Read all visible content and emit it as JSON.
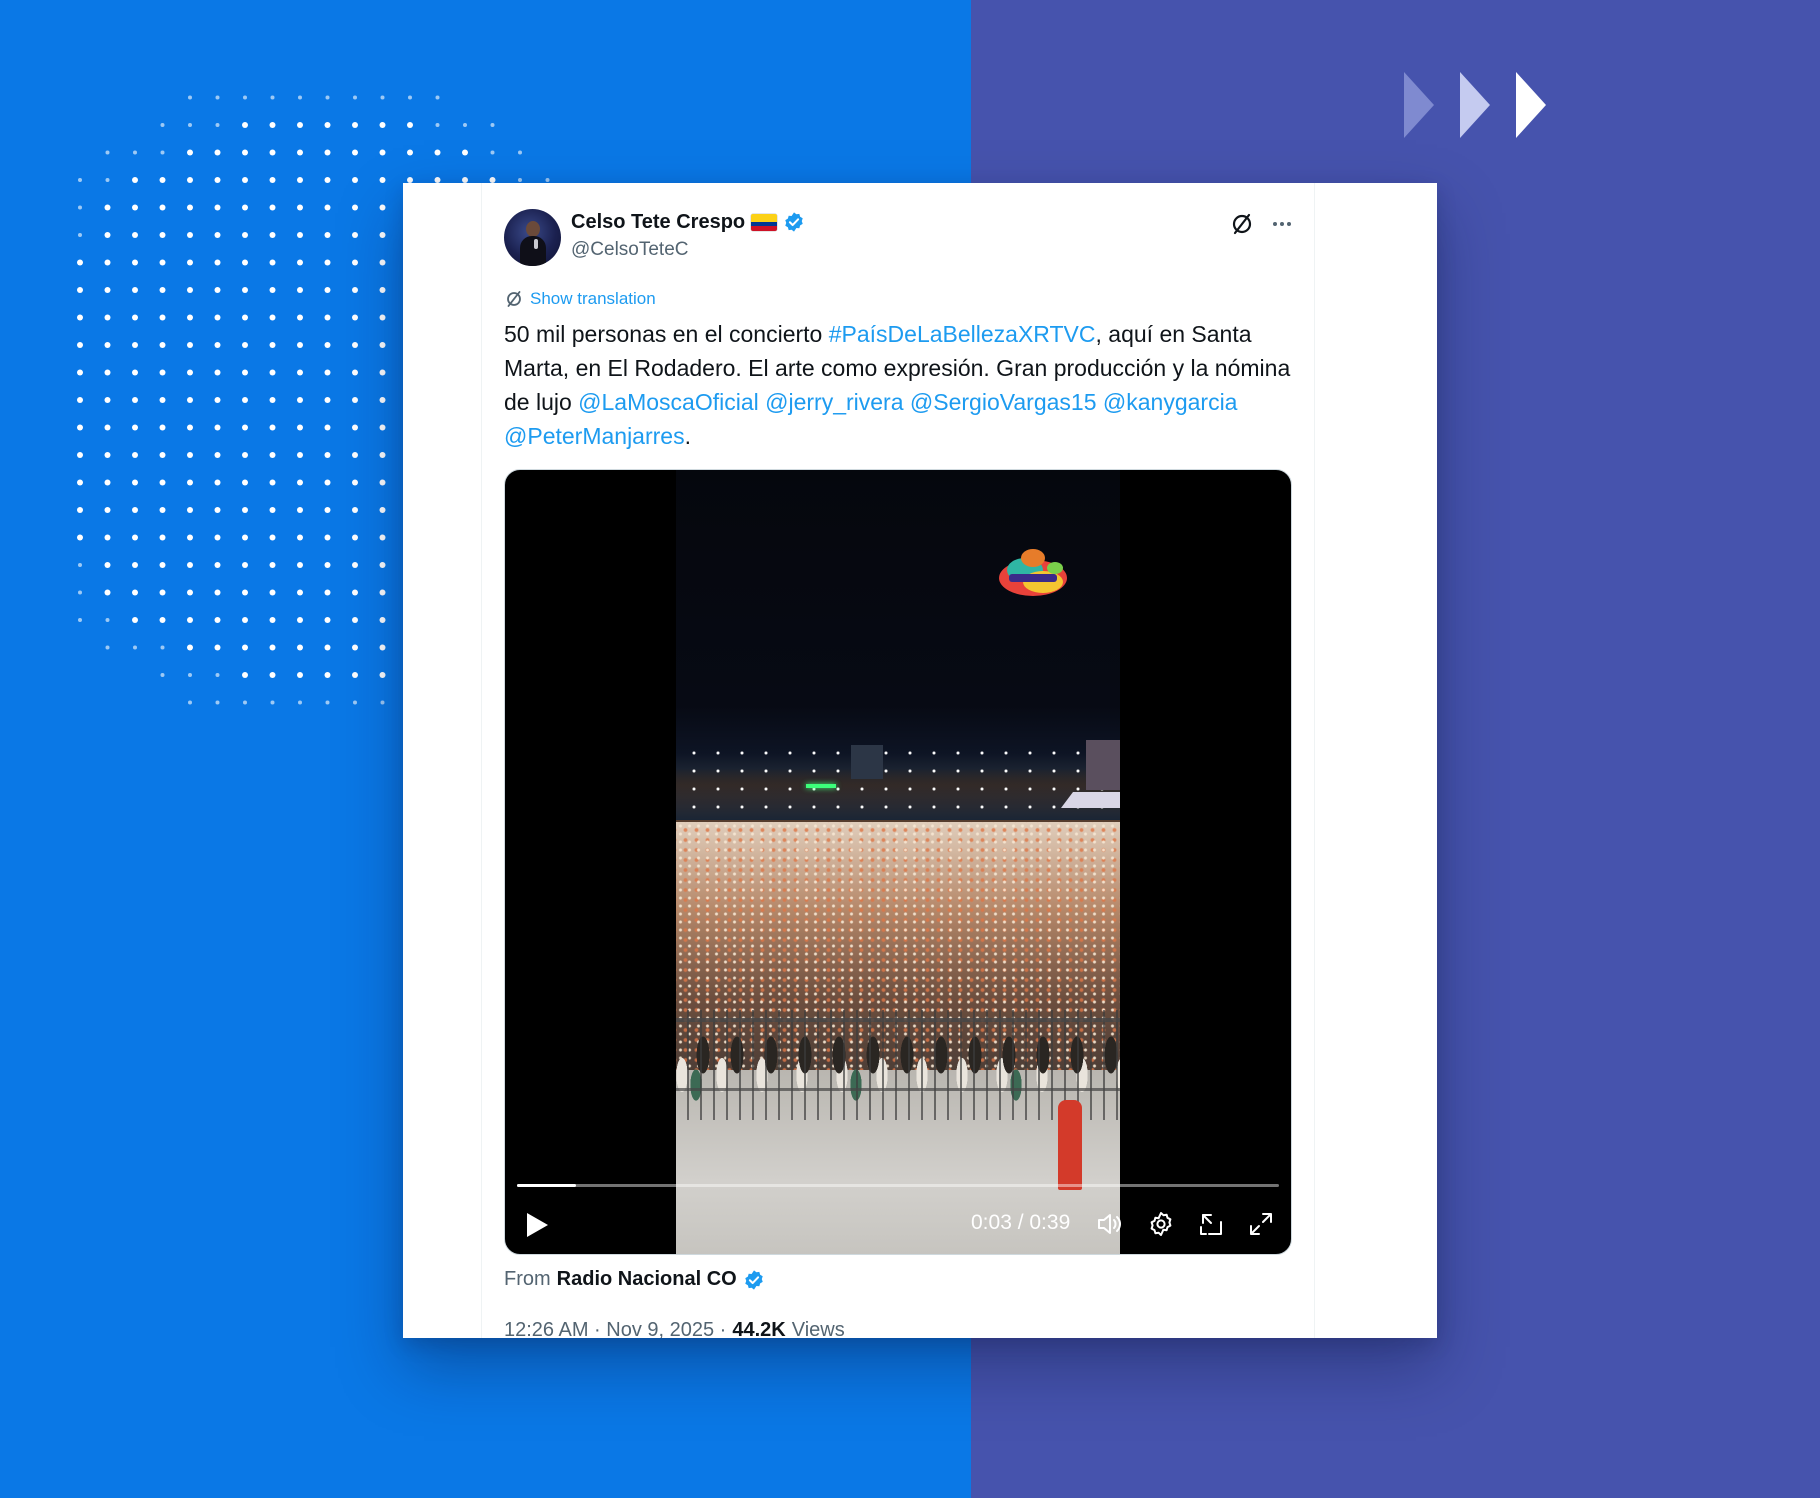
{
  "colors": {
    "bg_left": "#0a78e6",
    "bg_right": "#4653ad",
    "link_blue": "#1d9bf0",
    "text_primary": "#0f1419",
    "text_secondary": "#536471"
  },
  "tweet": {
    "author": {
      "display_name": "Celso Tete Crespo",
      "flag_icon": "colombia-flag-icon",
      "verified_icon": "verified-badge-icon",
      "handle": "@CelsoTeteC"
    },
    "header_icons": [
      "grok-icon",
      "more-icon"
    ],
    "translate_label": "Show translation",
    "text": {
      "part1": "50 mil personas en el concierto ",
      "hashtag": "#PaísDeLaBellezaXRTVC",
      "part2": ", aquí en Santa Marta, en El Rodadero. El arte como expresión. Gran producción y la nómina de lujo ",
      "mention1": "@LaMoscaOficial",
      "mention2": "@jerry_rivera",
      "mention3": "@SergioVargas15",
      "mention4": "@kanygarcia",
      "mention5": "@PeterManjarres",
      "end": "."
    },
    "video": {
      "time_display": "0:03 / 0:39",
      "progress": 0.077,
      "controls": [
        "play-icon",
        "volume-icon",
        "settings-icon",
        "picture-in-picture-icon",
        "fullscreen-icon"
      ]
    },
    "source": {
      "from_label": "From",
      "name": "Radio Nacional CO"
    },
    "meta": {
      "timestamp": "12:26 AM · Nov 9, 2025 ·",
      "views_count": "44.2K",
      "views_label": "Views"
    }
  }
}
